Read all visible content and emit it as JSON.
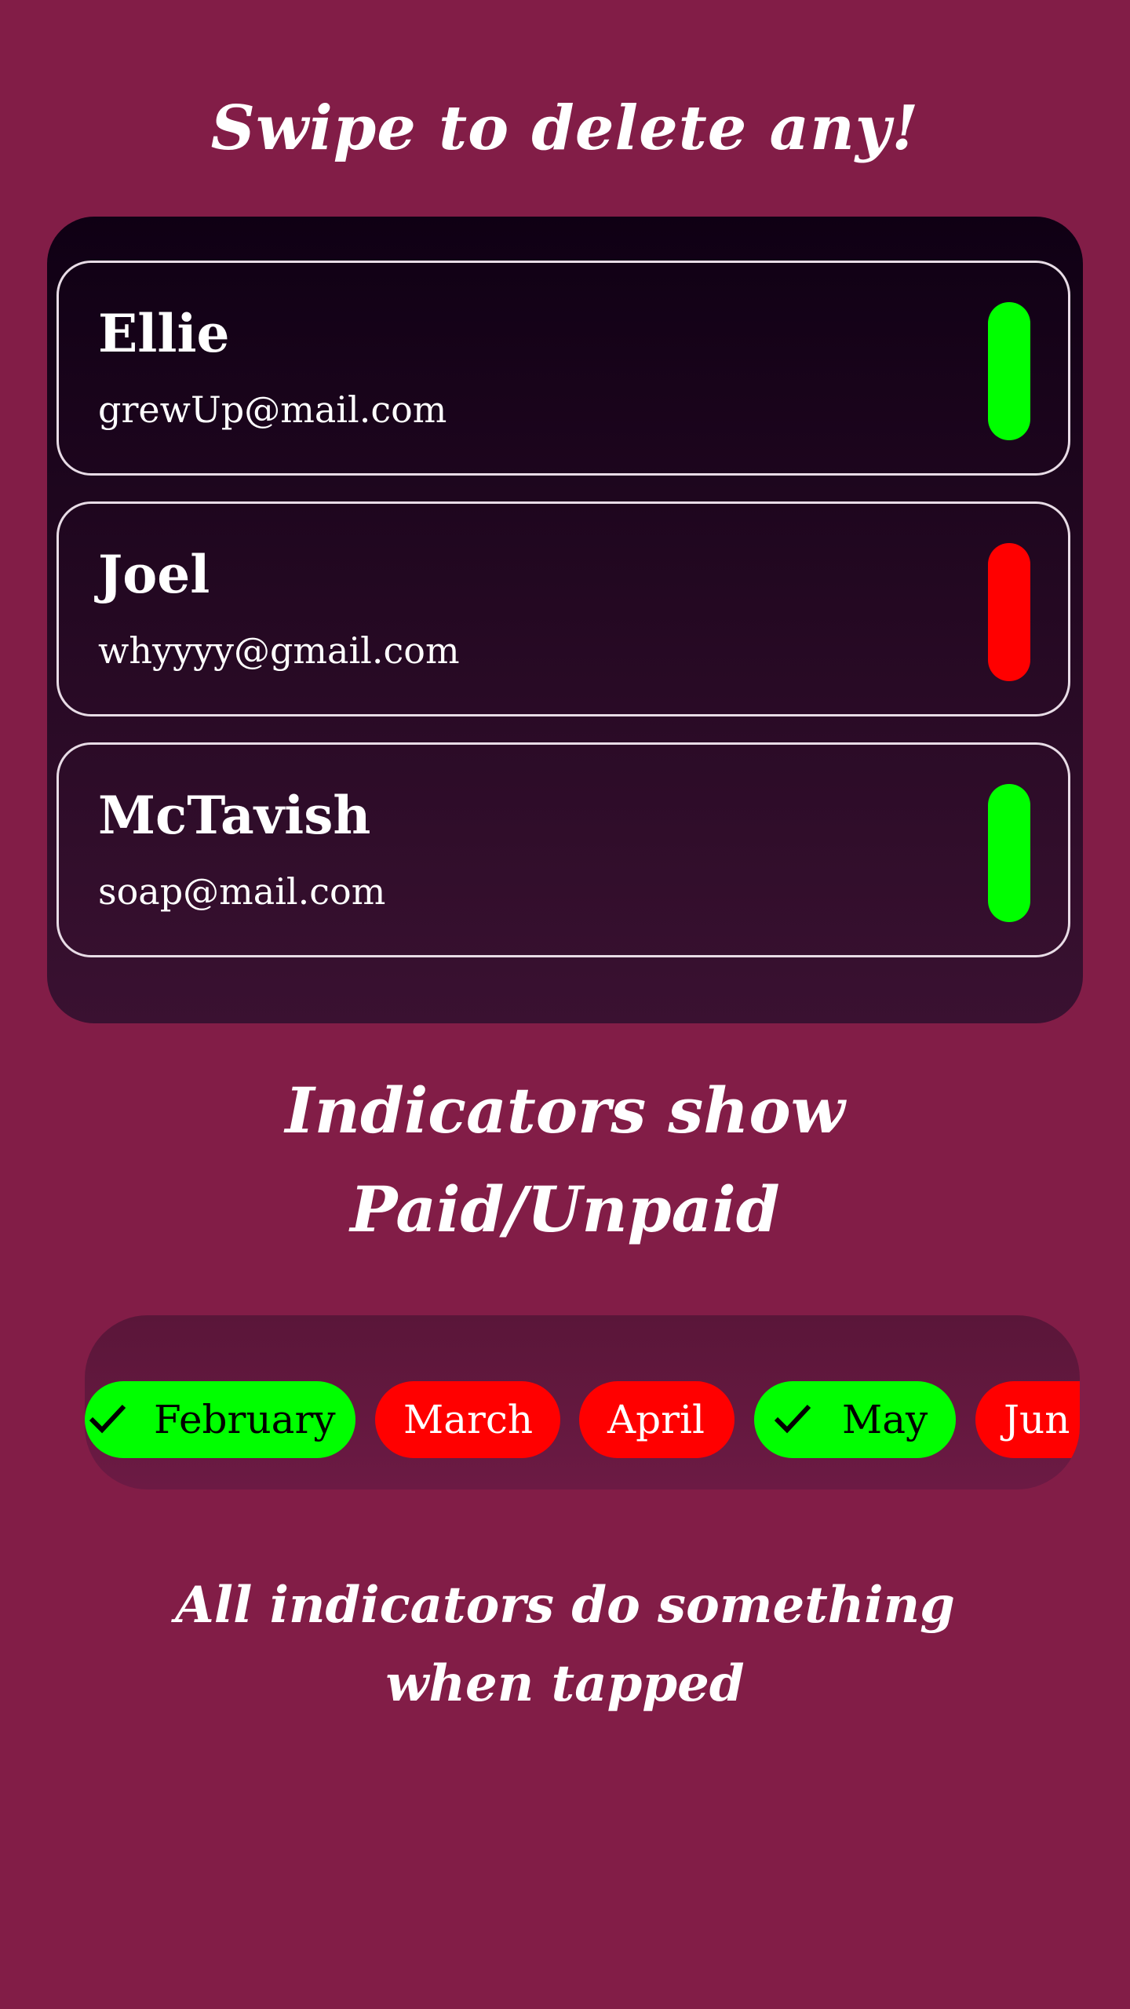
{
  "headings": {
    "swipe": "Swipe to delete any!",
    "indicators_line1": "Indicators show",
    "indicators_line2": "Paid/Unpaid",
    "tapped_line1": "All indicators do something",
    "tapped_line2": "when tapped"
  },
  "colors": {
    "background": "#821d47",
    "paid": "#00ff00",
    "unpaid": "#ff0000",
    "panel_dark": "#0f0014"
  },
  "contacts": [
    {
      "name": "Ellie",
      "email": "grewUp@mail.com",
      "status": "paid"
    },
    {
      "name": "Joel",
      "email": "whyyyy@gmail.com",
      "status": "unpaid"
    },
    {
      "name": "McTavish",
      "email": "soap@mail.com",
      "status": "paid"
    }
  ],
  "months": [
    {
      "label": "February",
      "status": "paid",
      "icon": "check-icon"
    },
    {
      "label": "March",
      "status": "unpaid"
    },
    {
      "label": "April",
      "status": "unpaid"
    },
    {
      "label": "May",
      "status": "paid",
      "icon": "check-icon"
    },
    {
      "label": "Jun",
      "status": "unpaid"
    }
  ]
}
